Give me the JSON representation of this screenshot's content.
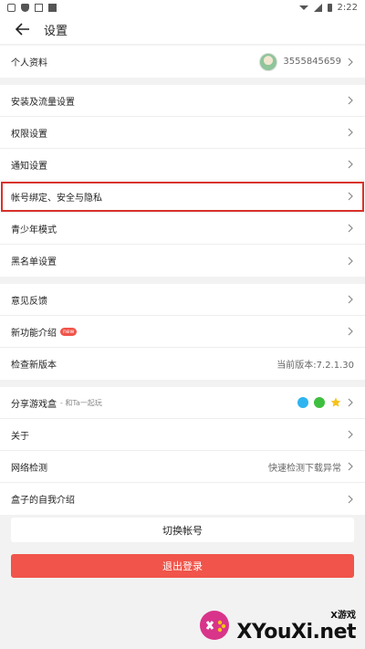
{
  "status": {
    "time": "2:22"
  },
  "appbar": {
    "title": "设置"
  },
  "profile": {
    "label": "个人资料",
    "user_id": "3555845659"
  },
  "group1": [
    {
      "label": "安装及流量设置"
    },
    {
      "label": "权限设置"
    },
    {
      "label": "通知设置"
    },
    {
      "label": "帐号绑定、安全与隐私"
    },
    {
      "label": "青少年模式"
    },
    {
      "label": "黑名单设置"
    }
  ],
  "group2": {
    "feedback": "意见反馈",
    "new_features": "新功能介绍",
    "new_badge": "new",
    "check_version": "检查新版本",
    "version_value": "当前版本:7.2.1.30"
  },
  "group3": {
    "share": "分享游戏盒",
    "share_sub": "- 和Ta一起玩",
    "about": "关于",
    "network": "网络检测",
    "network_value": "快速检测下载异常",
    "intro": "盒子的自我介绍"
  },
  "buttons": {
    "switch_account": "切换帐号",
    "logout": "退出登录"
  },
  "watermark": {
    "small": "X游戏",
    "big": "XYouXi.net"
  },
  "colors": {
    "accent": "#f0544a",
    "highlight_border": "#d9322a"
  },
  "icons": [
    "back-arrow-icon",
    "chevron-right-icon",
    "qq-icon",
    "wechat-icon",
    "star-icon"
  ]
}
